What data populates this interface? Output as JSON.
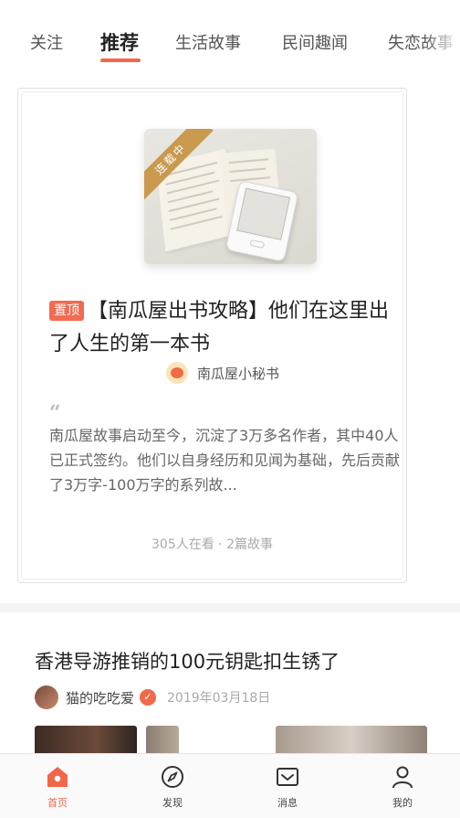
{
  "tabs": [
    {
      "label": "关注"
    },
    {
      "label": "推荐"
    },
    {
      "label": "生活故事"
    },
    {
      "label": "民间趣闻"
    },
    {
      "label": "失恋故事"
    }
  ],
  "active_tab_index": 1,
  "featured": {
    "cover_ribbon": "连载中",
    "pin_badge": "置顶",
    "title": "【南瓜屋出书攻略】他们在这里出了人生的第一本书",
    "author": "南瓜屋小秘书",
    "quote_mark": "“",
    "excerpt": "南瓜屋故事启动至今，沉淀了3万多名作者，其中40人已正式签约。他们以自身经历和见闻为基础，先后贡献了3万字-100万字的系列故...",
    "stats": "305人在看 · 2篇故事"
  },
  "article": {
    "title": "香港导游推销的100元钥匙扣生锈了",
    "author": "猫的吃吃爱",
    "author_badge": "✓",
    "date": "2019年03月18日"
  },
  "bottom_nav": [
    {
      "label": "首页",
      "icon": "home-icon",
      "active": true
    },
    {
      "label": "发现",
      "icon": "compass-icon",
      "active": false
    },
    {
      "label": "消息",
      "icon": "mail-icon",
      "active": false
    },
    {
      "label": "我的",
      "icon": "user-icon",
      "active": false
    }
  ],
  "colors": {
    "accent": "#f0674a",
    "ribbon": "#c99a4e"
  }
}
